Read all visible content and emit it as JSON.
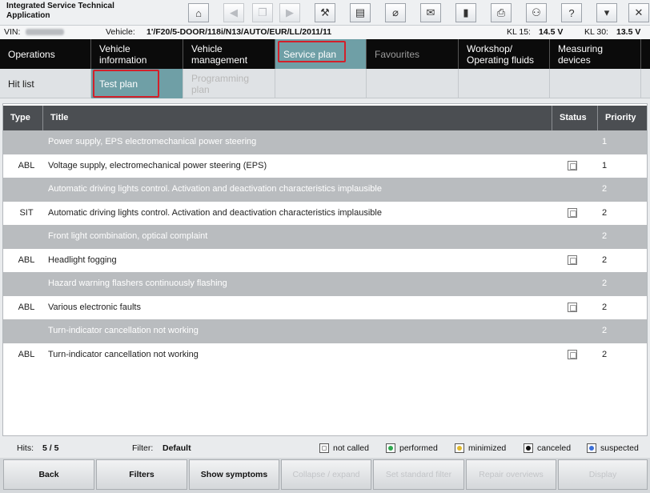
{
  "app": {
    "title": "Integrated Service Technical Application"
  },
  "toolbar": {
    "buttons": [
      {
        "name": "home-icon",
        "glyph": "⌂"
      },
      {
        "name": "arrow-left-icon",
        "glyph": "◀"
      },
      {
        "name": "copy-icon",
        "glyph": "❐"
      },
      {
        "name": "arrow-right-icon",
        "glyph": "▶"
      },
      {
        "name": "wrench-icon",
        "glyph": "⚒"
      },
      {
        "name": "book-icon",
        "glyph": "▤"
      },
      {
        "name": "connection-icon",
        "glyph": "⌀"
      },
      {
        "name": "mail-icon",
        "glyph": "✉"
      },
      {
        "name": "battery-icon",
        "glyph": "▮"
      },
      {
        "name": "printer-icon",
        "glyph": "⎙"
      },
      {
        "name": "user-search-icon",
        "glyph": "⚇"
      },
      {
        "name": "help-icon",
        "glyph": "?"
      },
      {
        "name": "minimize-icon",
        "glyph": "▾"
      },
      {
        "name": "close-icon",
        "glyph": "✕"
      }
    ]
  },
  "vehicle_info": {
    "vin_label": "VIN:",
    "vehicle_label": "Vehicle:",
    "vehicle_value": "1'/F20/5-DOOR/118i/N13/AUTO/EUR/LL/2011/11",
    "kl15_label": "KL 15:",
    "kl15_value": "14.5 V",
    "kl30_label": "KL 30:",
    "kl30_value": "13.5 V"
  },
  "main_nav": [
    {
      "label": "Operations"
    },
    {
      "label": "Vehicle information"
    },
    {
      "label": "Vehicle management"
    },
    {
      "label": "Service plan"
    },
    {
      "label": "Favourites"
    },
    {
      "label": "Workshop/ Operating fluids"
    },
    {
      "label": "Measuring devices"
    }
  ],
  "sub_nav": [
    {
      "label": "Hit list"
    },
    {
      "label": "Test plan"
    },
    {
      "label": "Programming plan"
    }
  ],
  "table": {
    "headers": {
      "type": "Type",
      "title": "Title",
      "status": "Status",
      "priority": "Priority"
    },
    "rows": [
      {
        "kind": "group",
        "type": "",
        "title": "Power supply, EPS electromechanical power steering",
        "priority": "1"
      },
      {
        "kind": "item",
        "type": "ABL",
        "title": "Voltage supply, electromechanical power steering (EPS)",
        "priority": "1"
      },
      {
        "kind": "group",
        "type": "",
        "title": "Automatic driving lights control. Activation and deactivation characteristics implausible",
        "priority": "2"
      },
      {
        "kind": "item",
        "type": "SIT",
        "title": "Automatic driving lights control. Activation and deactivation characteristics implausible",
        "priority": "2"
      },
      {
        "kind": "group",
        "type": "",
        "title": "Front light combination, optical complaint",
        "priority": "2"
      },
      {
        "kind": "item",
        "type": "ABL",
        "title": "Headlight fogging",
        "priority": "2"
      },
      {
        "kind": "group",
        "type": "",
        "title": "Hazard warning flashers continuously flashing",
        "priority": "2"
      },
      {
        "kind": "item",
        "type": "ABL",
        "title": "Various electronic faults",
        "priority": "2"
      },
      {
        "kind": "group",
        "type": "",
        "title": "Turn-indicator cancellation not working",
        "priority": "2"
      },
      {
        "kind": "item",
        "type": "ABL",
        "title": "Turn-indicator cancellation not working",
        "priority": "2"
      }
    ]
  },
  "status_bar": {
    "hits_label": "Hits:",
    "hits_value": "5 / 5",
    "filter_label": "Filter:",
    "filter_value": "Default",
    "legend": [
      {
        "label": "not called",
        "color": "#ffffff"
      },
      {
        "label": "performed",
        "color": "#2fa84f"
      },
      {
        "label": "minimized",
        "color": "#e0b92e"
      },
      {
        "label": "canceled",
        "color": "#111111"
      },
      {
        "label": "suspected",
        "color": "#3b6fd8"
      }
    ]
  },
  "footer_buttons": {
    "back": "Back",
    "filters": "Filters",
    "show_symptoms": "Show symptoms",
    "collapse_expand": "Collapse / expand",
    "set_standard_filter": "Set standard filter",
    "repair_overviews": "Repair overviews",
    "display": "Display"
  }
}
